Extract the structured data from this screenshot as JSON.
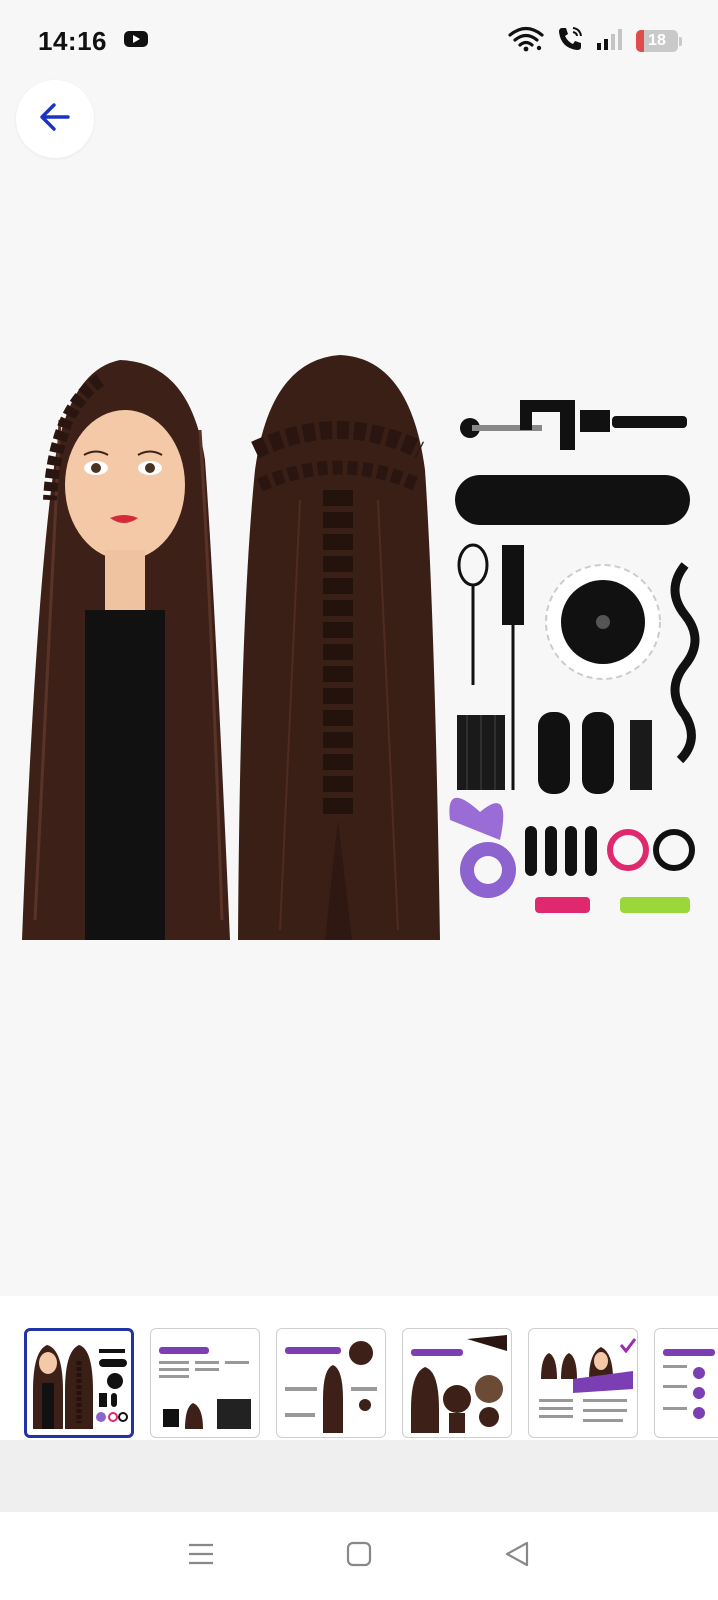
{
  "status_bar": {
    "time": "14:16",
    "battery_level": "18",
    "battery_fraction": 0.18,
    "battery_color": "#e04b4b",
    "icons": [
      "youtube-icon",
      "wifi-icon",
      "wifi-call-icon",
      "signal-icon",
      "battery-icon"
    ]
  },
  "toolbar": {
    "back_icon": "arrow-left-icon",
    "accent": "#1a33c4"
  },
  "gallery": {
    "selected_index": 0,
    "thumbnail_count": 6,
    "selected_border_color": "#2233a8",
    "thumbnail_accent": "#7b3fb3"
  },
  "nav_bar": {
    "icons": [
      "menu-icon",
      "home-icon",
      "back-triangle-icon"
    ]
  }
}
